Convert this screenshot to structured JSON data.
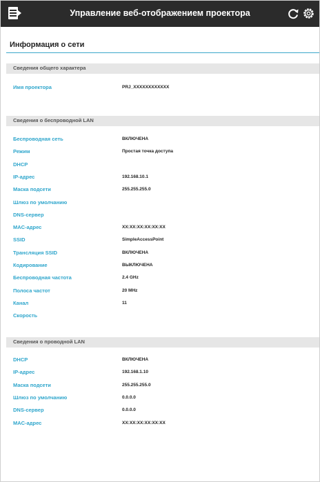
{
  "header": {
    "title": "Управление веб-отображением проектора",
    "background": "#2b2b2b"
  },
  "page_title": "Информация о сети",
  "accent_color": "#2fa6cc",
  "general": {
    "heading": "Сведения общего характера",
    "rows": [
      {
        "label": "Имя проектора",
        "value": "PRJ_XXXXXXXXXXXX"
      }
    ]
  },
  "wireless": {
    "heading": "Сведения о беспроводной LAN",
    "rows": [
      {
        "label": "Беспроводная сеть",
        "value": "ВКЛЮЧЕНА"
      },
      {
        "label": "Режим",
        "value": "Простая точка доступа"
      },
      {
        "label": "DHCP",
        "value": ""
      },
      {
        "label": "IP-адрес",
        "value": "192.168.10.1"
      },
      {
        "label": "Маска подсети",
        "value": "255.255.255.0"
      },
      {
        "label": "Шлюз по умолчанию",
        "value": ""
      },
      {
        "label": "DNS-сервер",
        "value": ""
      },
      {
        "label": "MAC-адрес",
        "value": "XX:XX:XX:XX:XX:XX"
      },
      {
        "label": "SSID",
        "value": "SimpleAccessPoint"
      },
      {
        "label": "Трансляция SSID",
        "value": "ВКЛЮЧЕНА"
      },
      {
        "label": "Кодирование",
        "value": "ВЫКЛЮЧЕНА"
      },
      {
        "label": "Беспроводная частота",
        "value": "2.4 GHz"
      },
      {
        "label": "Полоса частот",
        "value": "20 MHz"
      },
      {
        "label": "Канал",
        "value": "11"
      },
      {
        "label": "Скорость",
        "value": ""
      }
    ]
  },
  "wired": {
    "heading": "Сведения о проводной LAN",
    "rows": [
      {
        "label": "DHCP",
        "value": "ВКЛЮЧЕНА"
      },
      {
        "label": "IP-адрес",
        "value": "192.168.1.10"
      },
      {
        "label": "Маска подсети",
        "value": "255.255.255.0"
      },
      {
        "label": "Шлюз по умолчанию",
        "value": "0.0.0.0"
      },
      {
        "label": "DNS-сервер",
        "value": "0.0.0.0"
      },
      {
        "label": "MAC-адрес",
        "value": "XX:XX:XX:XX:XX:XX"
      }
    ]
  },
  "icons": {
    "menu": "menu-icon",
    "refresh": "refresh-icon",
    "settings": "settings-icon"
  }
}
